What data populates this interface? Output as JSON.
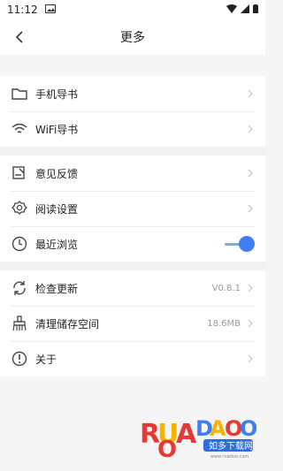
{
  "status": {
    "time": "11:12"
  },
  "header": {
    "title": "更多"
  },
  "groups": [
    {
      "items": [
        {
          "label": "手机导书"
        },
        {
          "label": "WiFi导书"
        }
      ]
    },
    {
      "items": [
        {
          "label": "意见反馈"
        },
        {
          "label": "阅读设置"
        },
        {
          "label": "最近浏览"
        }
      ]
    },
    {
      "items": [
        {
          "label": "检查更新",
          "value": "V0.8.1"
        },
        {
          "label": "清理储存空间",
          "value": "18.6MB"
        },
        {
          "label": "关于"
        }
      ]
    }
  ],
  "colors": {
    "accent": "#3f7df2"
  },
  "watermark": {
    "brand": "RUANDAOO",
    "sub": "如多下载网",
    "url": "www.ruaduo.com"
  }
}
